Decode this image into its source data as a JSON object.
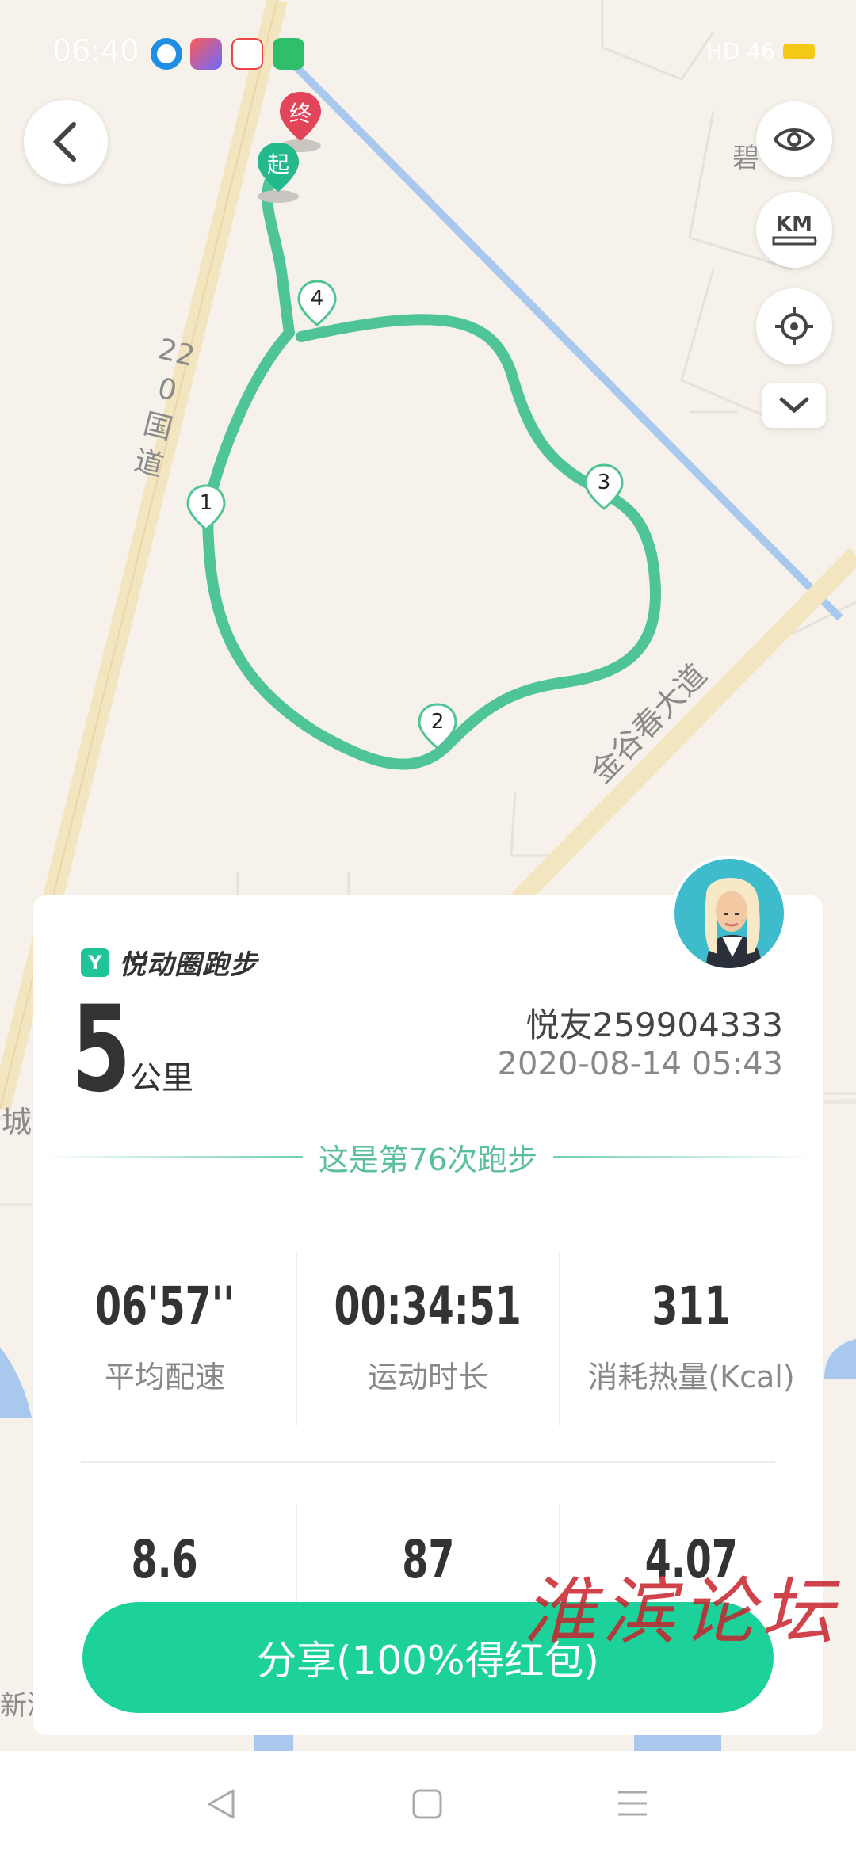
{
  "status_bar": {
    "time": "06:40",
    "network": "HD 46"
  },
  "map": {
    "road_labels": [
      "220国道",
      "金谷春大道",
      "城",
      "新淮",
      "碧"
    ],
    "start_marker": "起",
    "end_marker": "终",
    "lap_markers": [
      "1",
      "2",
      "3",
      "4"
    ]
  },
  "controls": {
    "back": "back",
    "km_label": "KM"
  },
  "card": {
    "brand_name": "悦动圈跑步",
    "distance_value": "5",
    "distance_unit": "公里",
    "username": "悦友259904333",
    "datetime": "2020-08-14 05:43",
    "run_count_text": "这是第76次跑步",
    "stats_row1": [
      {
        "value": "06'57''",
        "label": "平均配速"
      },
      {
        "value": "00:34:51",
        "label": "运动时长"
      },
      {
        "value": "311",
        "label": "消耗热量(Kcal)"
      }
    ],
    "stats_row2": [
      {
        "value": "8.6"
      },
      {
        "value": "87"
      },
      {
        "value": "4.07"
      }
    ]
  },
  "share_button": "分享(100%得红包)",
  "watermark": "淮滨论坛",
  "colors": {
    "route": "#4fc496",
    "accent": "#1dd19a",
    "end_marker": "#e2455a",
    "start_marker": "#23b98c"
  }
}
